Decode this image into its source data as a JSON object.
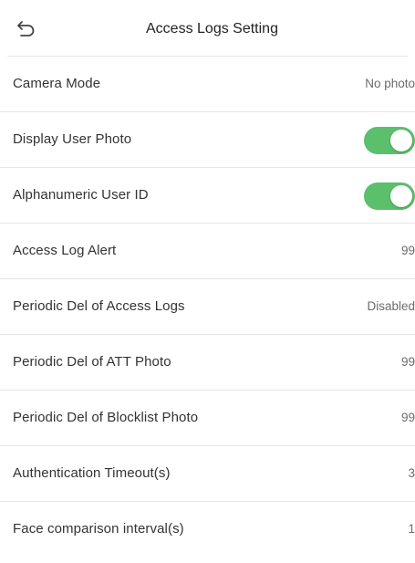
{
  "header": {
    "title": "Access Logs Setting",
    "back_icon": "back-arrow-icon"
  },
  "colors": {
    "toggle_on": "#5bbf6c",
    "divider": "#e6e6e6",
    "text": "#333333",
    "value_text": "#6b6b6b"
  },
  "settings": [
    {
      "label": "Camera Mode",
      "type": "value",
      "value": "No photo"
    },
    {
      "label": "Display User Photo",
      "type": "toggle",
      "on": true
    },
    {
      "label": "Alphanumeric User ID",
      "type": "toggle",
      "on": true
    },
    {
      "label": "Access Log Alert",
      "type": "value",
      "value": "99"
    },
    {
      "label": "Periodic Del of Access Logs",
      "type": "value",
      "value": "Disabled"
    },
    {
      "label": "Periodic Del of ATT Photo",
      "type": "value",
      "value": "99"
    },
    {
      "label": "Periodic Del of Blocklist Photo",
      "type": "value",
      "value": "99"
    },
    {
      "label": "Authentication Timeout(s)",
      "type": "value",
      "value": "3"
    },
    {
      "label": "Face comparison interval(s)",
      "type": "value",
      "value": "1"
    }
  ]
}
